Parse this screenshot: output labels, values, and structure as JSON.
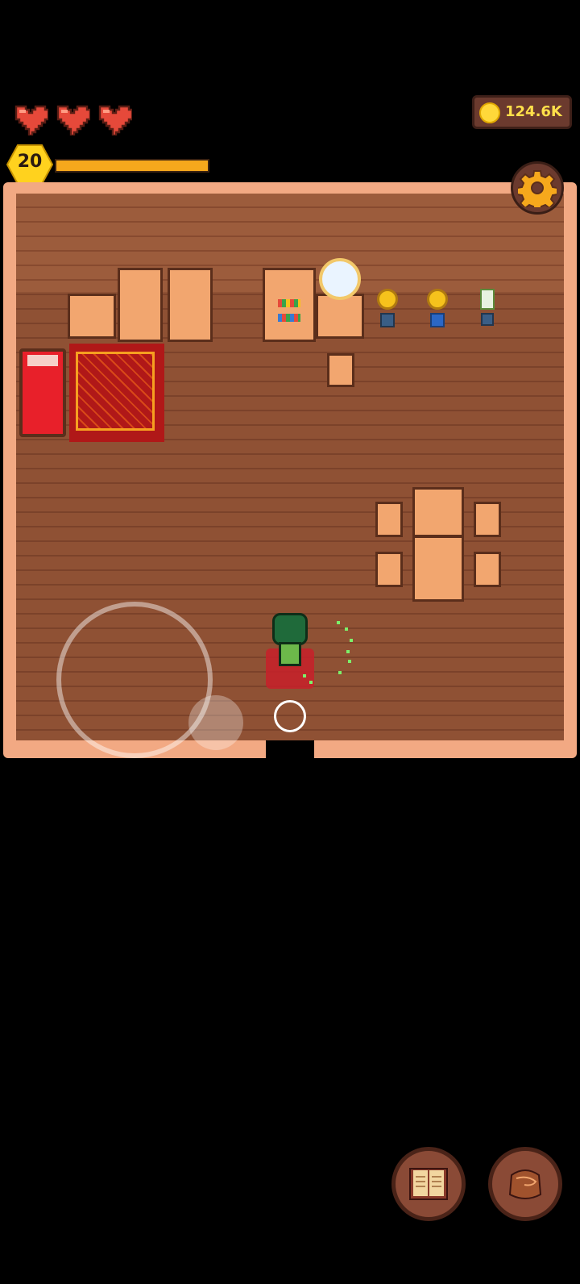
{
  "hud": {
    "hearts": [
      "heart-full",
      "heart-full",
      "heart-full"
    ],
    "coins": "124.6K",
    "level": "20",
    "xp_fraction": 1.0,
    "settings_icon": "gear-icon"
  },
  "buttons": {
    "journal_icon": "book-icon",
    "bag_icon": "bag-icon"
  },
  "colors": {
    "floor": "#8f5134",
    "wall": "#f2a983",
    "xp": "#f6a81c",
    "coin": "#ffe04a"
  }
}
